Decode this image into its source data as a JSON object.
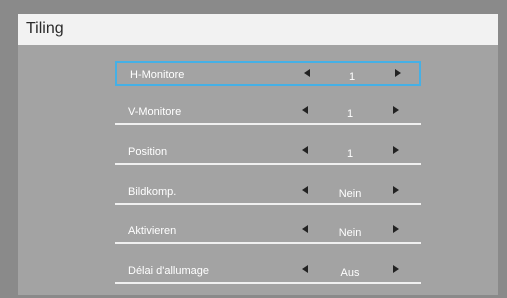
{
  "menu": {
    "title": "Tiling",
    "items": [
      {
        "label": "H-Monitore",
        "value": "1",
        "selected": true
      },
      {
        "label": "V-Monitore",
        "value": "1",
        "selected": false
      },
      {
        "label": "Position",
        "value": "1",
        "selected": false
      },
      {
        "label": "Bildkomp.",
        "value": "Nein",
        "selected": false
      },
      {
        "label": "Aktivieren",
        "value": "Nein",
        "selected": false
      },
      {
        "label": "Délai d'allumage",
        "value": "Aus",
        "selected": false
      }
    ]
  },
  "colors": {
    "panel": "#a3a3a3",
    "title_bar": "#f2f2f2",
    "selection": "#45b0e6",
    "text": "#ffffff"
  }
}
